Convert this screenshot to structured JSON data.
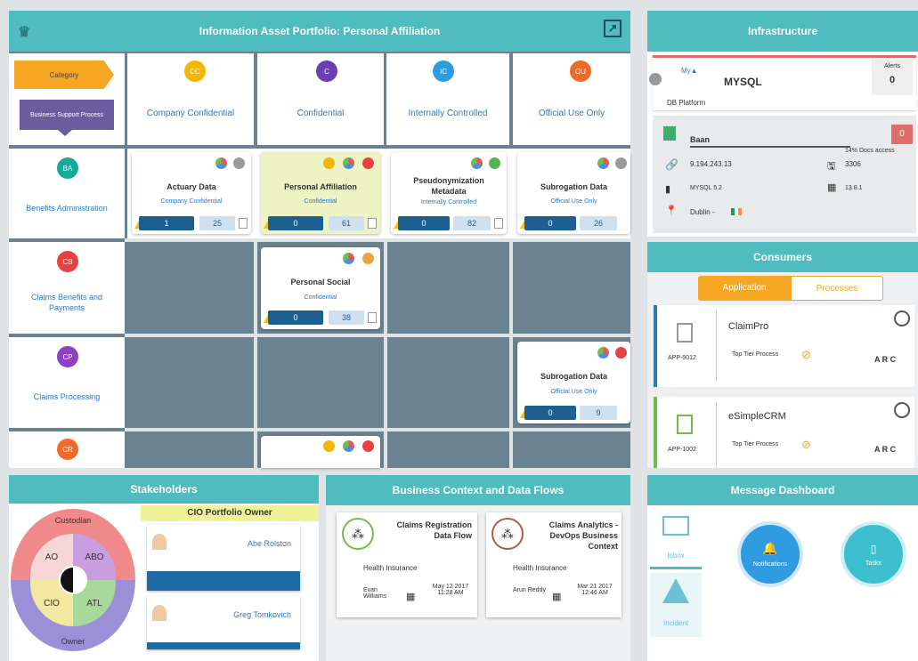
{
  "portfolio": {
    "title": "Information Asset Portfolio: Personal Affiliation",
    "category_label": "Category",
    "bsp_label": "Business Support Process",
    "columns": [
      {
        "code": "CC",
        "label": "Company Confidential",
        "color": "#f2b705"
      },
      {
        "code": "C",
        "label": "Confidential",
        "color": "#6a3fb5"
      },
      {
        "code": "IC",
        "label": "Internally Controlled",
        "color": "#2f9be0"
      },
      {
        "code": "OU",
        "label": "Official Use Only",
        "color": "#f06a2a"
      }
    ],
    "rows": [
      {
        "code": "BA",
        "label": "Benefits Administration",
        "color": "#17a99a"
      },
      {
        "code": "CB",
        "label": "Claims Benefits and Payments",
        "color": "#e84141"
      },
      {
        "code": "CP",
        "label": "Claims Processing",
        "color": "#8e3fc2"
      },
      {
        "code": "CR",
        "label": "",
        "color": "#f06a2a"
      }
    ],
    "cards": [
      {
        "title": "Actuary Data",
        "sub": "Company Confidential",
        "count": "1",
        "docs": "25"
      },
      {
        "title": "Personal Affiliation",
        "sub": "Confidential",
        "count": "0",
        "docs": "61"
      },
      {
        "title": "Pseudonymization Metadata",
        "sub": "Internally Controlled",
        "count": "0",
        "docs": "82"
      },
      {
        "title": "Subrogation Data",
        "sub": "Official Use Only",
        "count": "0",
        "docs": "26"
      },
      {
        "title": "Personal Social",
        "sub": "Confidential",
        "count": "0",
        "docs": "38"
      },
      {
        "title": "Subrogation Data",
        "sub": "Official Use Only",
        "count": "0",
        "docs": "9"
      }
    ]
  },
  "infrastructure": {
    "title": "Infrastructure",
    "db_name": "MYSQL",
    "db_platform": "DB Platform",
    "alerts_label": "Alerts",
    "alerts_value": "0",
    "server_name": "Baan",
    "badge": "0",
    "doc_access": "14% Docs access",
    "ip": "9.194.243.13",
    "port": "3306",
    "version": "MYSQL 5.2",
    "size": "13.8.1",
    "location": "Dublin - "
  },
  "consumers": {
    "title": "Consumers",
    "tab_application": "Application",
    "tab_processes": "Processes",
    "apps": [
      {
        "name": "ClaimPro",
        "id": "APP-9012",
        "tier": "Top Tier Process",
        "arc": "A R C"
      },
      {
        "name": "eSimpleCRM",
        "id": "APP-1002",
        "tier": "Top Tier Process",
        "arc": "A R C"
      }
    ]
  },
  "stakeholders": {
    "title": "Stakeholders",
    "custodian": "Custodian",
    "owner": "Owner",
    "ao": "AO",
    "abo": "ABO",
    "cio": "CIO",
    "atl": "ATL",
    "portfolio_owner": "CIO Portfolio Owner",
    "people": [
      "Abe Rolston",
      "Greg Tomkovich"
    ]
  },
  "business": {
    "title": "Business Context and Data Flows",
    "flows": [
      {
        "name": "Claims Registration Data Flow",
        "cat": "Health Insurance",
        "user": "Evan Williams",
        "date": "May 12 2017 11:28 AM"
      },
      {
        "name": "Claims Analytics - DevOps Business Context",
        "cat": "Health Insurance",
        "user": "Arun Reddy",
        "date": "Mar 21 2017 12:46 AM"
      }
    ]
  },
  "messages": {
    "title": "Message Dashboard",
    "inbox": "Inbox",
    "incident": "Incident",
    "notifications": "Notifications",
    "tasks": "Tasks"
  }
}
